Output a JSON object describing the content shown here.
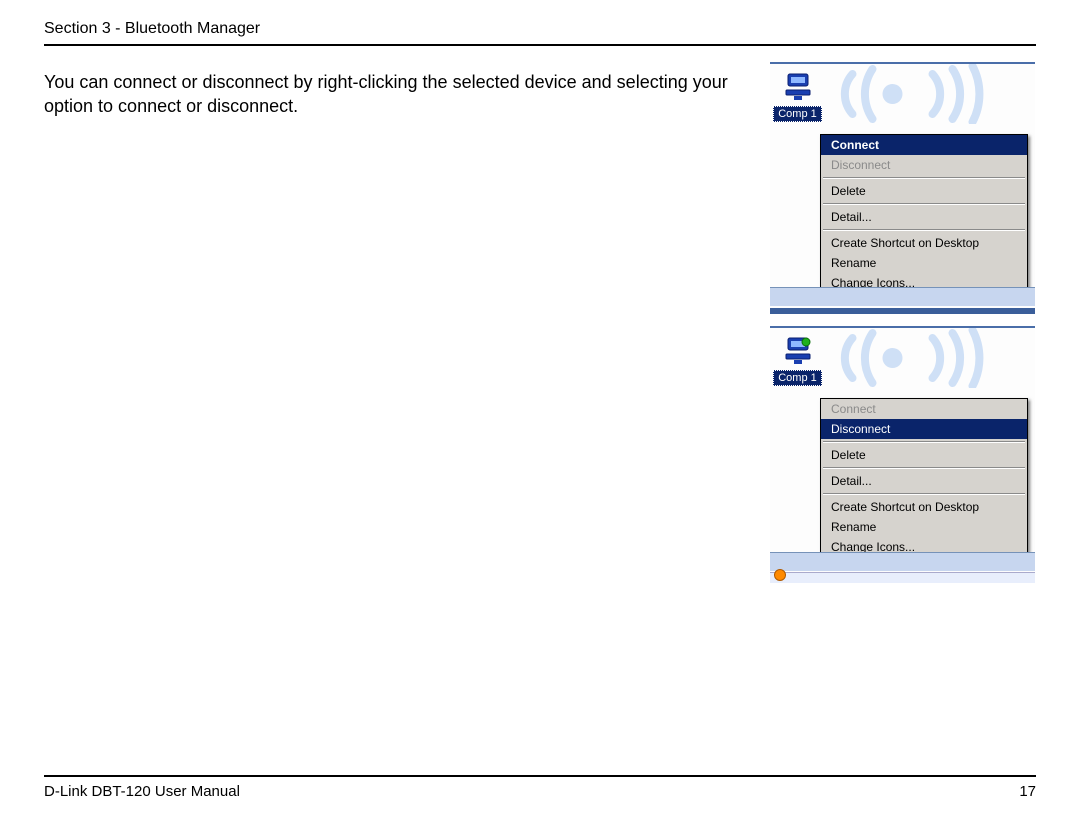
{
  "header": {
    "section_title": "Section 3 - Bluetooth Manager"
  },
  "body": {
    "paragraph": "You can connect or disconnect by right-clicking the selected device and selecting your option to connect or disconnect."
  },
  "figure1": {
    "device_label": "Comp 1",
    "menu": {
      "connect": "Connect",
      "disconnect": "Disconnect",
      "delete": "Delete",
      "detail": "Detail...",
      "shortcut": "Create Shortcut on Desktop",
      "rename": "Rename",
      "change_icons": "Change Icons..."
    }
  },
  "figure2": {
    "device_label": "Comp 1",
    "menu": {
      "connect": "Connect",
      "disconnect": "Disconnect",
      "delete": "Delete",
      "detail": "Detail...",
      "shortcut": "Create Shortcut on Desktop",
      "rename": "Rename",
      "change_icons": "Change Icons..."
    }
  },
  "footer": {
    "manual": "D-Link DBT-120 User Manual",
    "page": "17"
  }
}
